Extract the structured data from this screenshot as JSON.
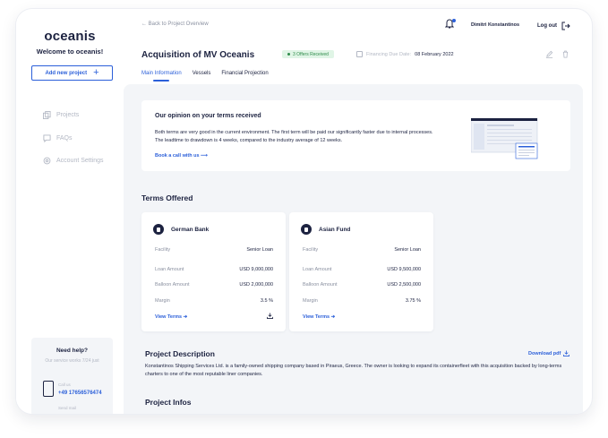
{
  "sidebar": {
    "logo": "oceanis",
    "welcome": "Welcome to oceanis!",
    "add_project": "Add new project",
    "nav": [
      {
        "label": "Projects",
        "icon": "projects-icon"
      },
      {
        "label": "FAQs",
        "icon": "chat-icon"
      },
      {
        "label": "Account Settings",
        "icon": "gear-icon"
      }
    ],
    "help": {
      "title": "Need help?",
      "subtitle": "Our service works 7/24 just",
      "call_label": "Call us",
      "phone": "+49 17656576474",
      "send_mail": "Send mail"
    }
  },
  "header": {
    "back": "← Back to Project Overview",
    "user": "Dimitri Konstantinos",
    "logout": "Log out"
  },
  "project": {
    "title": "Acquisition of MV Oceanis",
    "badge": "3 Offers Received",
    "due_label": "Financing Due Date:",
    "due_value": "08 February 2022",
    "tabs": [
      "Main Information",
      "Vessels",
      "Financial Projection"
    ],
    "active_tab": 0
  },
  "opinion": {
    "title": "Our opinion on your terms received",
    "text": "Both terms are very good in the current environment. The first term will be paid our significantly faster due to internal processes. The leadtime to drawdown is 4 weeks, compared to the industry average of 12 weeks.",
    "link": "Book a call with us ⟶"
  },
  "terms": {
    "title": "Terms Offered",
    "cards": [
      {
        "bank": "German Bank",
        "facility_label": "Facility",
        "facility": "Senior Loan",
        "loan_label": "Loan Amount",
        "loan": "USD 9,000,000",
        "balloon_label": "Balloon Amount",
        "balloon": "USD 2,000,000",
        "margin_label": "Margin",
        "margin": "3.5 %",
        "view": "View Terms ➔"
      },
      {
        "bank": "Asian Fund",
        "facility_label": "Facility",
        "facility": "Senior Loan",
        "loan_label": "Loan Amount",
        "loan": "USD 9,500,000",
        "balloon_label": "Balloon Amount",
        "balloon": "USD 2,500,000",
        "margin_label": "Margin",
        "margin": "3.75 %",
        "view": "View Terms ➔"
      }
    ]
  },
  "description": {
    "title": "Project Description",
    "download": "Download pdf",
    "text": "Konstantinos Shipping Services Ltd. is a family-owned shipping company based in Piraeus, Greece. The owner is looking to expand its containerfleet with this acquisition backed by long-terms charters to one of the most reputable liner companies."
  },
  "infos": {
    "title": "Project Infos"
  },
  "colors": {
    "accent": "#2b5fd9",
    "text": "#1c2240",
    "muted": "#b3b8c4",
    "background": "#f3f5f8",
    "badge_bg": "#e0f5e6",
    "badge_text": "#2e8b4a"
  }
}
